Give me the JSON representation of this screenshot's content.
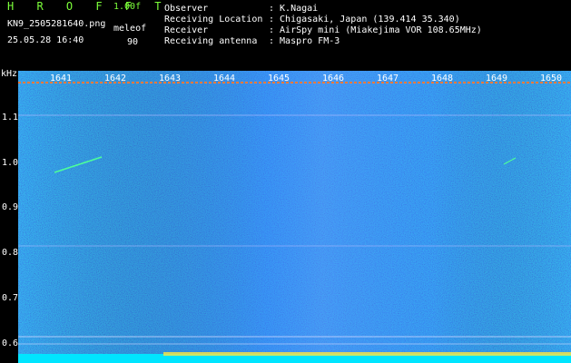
{
  "header": {
    "title": "H R O F F T",
    "version": "1.00f",
    "file_name": "KN9_2505281640.png",
    "date_time": "25.05.28 16:40",
    "mode_label": "meleof",
    "mode_value": "90"
  },
  "meta": [
    {
      "key": "Observer",
      "value": ": K.Nagai"
    },
    {
      "key": "Receiving Location",
      "value": ": Chigasaki, Japan (139.414 35.340)"
    },
    {
      "key": "Receiver",
      "value": ": AirSpy mini (Miakejima VOR 108.65MHz)"
    },
    {
      "key": "Receiving antenna",
      "value": ": Maspro FM-3"
    }
  ],
  "axis": {
    "unit": "kHz",
    "y_ticks": [
      "1.1",
      "1.0",
      "0.9",
      "0.8",
      "0.7",
      "0.6"
    ],
    "x_ticks": [
      "1641",
      "1642",
      "1643",
      "1644",
      "1645",
      "1646",
      "1647",
      "1648",
      "1649",
      "1650"
    ]
  },
  "colors": {
    "background": "#000000",
    "title_green": "#7CFF3A",
    "noise_base": "#0a1a8a",
    "noise_bright": "#2f5bff",
    "bottom_band": "#00e5ff"
  }
}
